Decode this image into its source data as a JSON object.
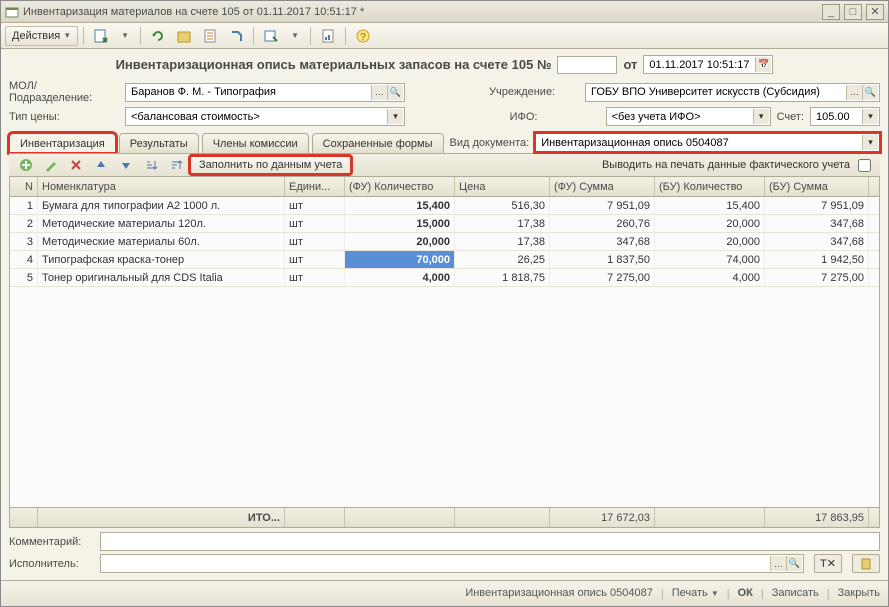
{
  "window": {
    "title": "Инвентаризация материалов на счете 105  от 01.11.2017 10:51:17 *"
  },
  "toolbar": {
    "actions": "Действия"
  },
  "header": {
    "title": "Инвентаризационная опись материальных запасов на счете 105 №",
    "number": "",
    "from_label": "от",
    "date": "01.11.2017 10:51:17"
  },
  "fields": {
    "mol_label": "МОЛ/Подразделение:",
    "mol_value": "Баранов Ф. М. - Типография",
    "pricetype_label": "Тип цены:",
    "pricetype_value": "<балансовая стоимость>",
    "org_label": "Учреждение:",
    "org_value": "ГОБУ ВПО Университет искусств (Субсидия)",
    "ifo_label": "ИФО:",
    "ifo_value": "<без учета ИФО>",
    "acct_label": "Счет:",
    "acct_value": "105.00",
    "doctype_label": "Вид документа:",
    "doctype_value": "Инвентаризационная опись 0504087"
  },
  "tabs": {
    "t1": "Инвентаризация",
    "t2": "Результаты",
    "t3": "Члены комиссии",
    "t4": "Сохраненные формы"
  },
  "sub": {
    "fill_btn": "Заполнить по данным учета",
    "print_actual": "Выводить на печать данные фактического учета"
  },
  "grid": {
    "headers": {
      "n": "N",
      "nom": "Номенклатура",
      "ed": "Едини...",
      "fu_qty": "(ФУ) Количество",
      "price": "Цена",
      "fu_sum": "(ФУ) Сумма",
      "bu_qty": "(БУ) Количество",
      "bu_sum": "(БУ) Сумма"
    },
    "rows": [
      {
        "n": "1",
        "nom": "Бумага для типографии А2 1000 л.",
        "ed": "шт",
        "fu_qty": "15,400",
        "price": "516,30",
        "fu_sum": "7 951,09",
        "bu_qty": "15,400",
        "bu_sum": "7 951,09"
      },
      {
        "n": "2",
        "nom": "Методические материалы 120л.",
        "ed": "шт",
        "fu_qty": "15,000",
        "price": "17,38",
        "fu_sum": "260,76",
        "bu_qty": "20,000",
        "bu_sum": "347,68"
      },
      {
        "n": "3",
        "nom": "Методические материалы 60л.",
        "ed": "шт",
        "fu_qty": "20,000",
        "price": "17,38",
        "fu_sum": "347,68",
        "bu_qty": "20,000",
        "bu_sum": "347,68"
      },
      {
        "n": "4",
        "nom": "Типографская краска-тонер",
        "ed": "шт",
        "fu_qty": "70,000",
        "price": "26,25",
        "fu_sum": "1 837,50",
        "bu_qty": "74,000",
        "bu_sum": "1 942,50"
      },
      {
        "n": "5",
        "nom": "Тонер оригинальный для CDS Italia",
        "ed": "шт",
        "fu_qty": "4,000",
        "price": "1 818,75",
        "fu_sum": "7 275,00",
        "bu_qty": "4,000",
        "bu_sum": "7 275,00"
      }
    ],
    "footer": {
      "label": "ИТО...",
      "fu_sum": "17 672,03",
      "bu_sum": "17 863,95"
    }
  },
  "bottom": {
    "comment_label": "Комментарий:",
    "comment_value": "",
    "exec_label": "Исполнитель:",
    "exec_value": ""
  },
  "status": {
    "doc": "Инвентаризационная опись 0504087",
    "print": "Печать",
    "ok": "ОК",
    "save": "Записать",
    "close": "Закрыть"
  }
}
